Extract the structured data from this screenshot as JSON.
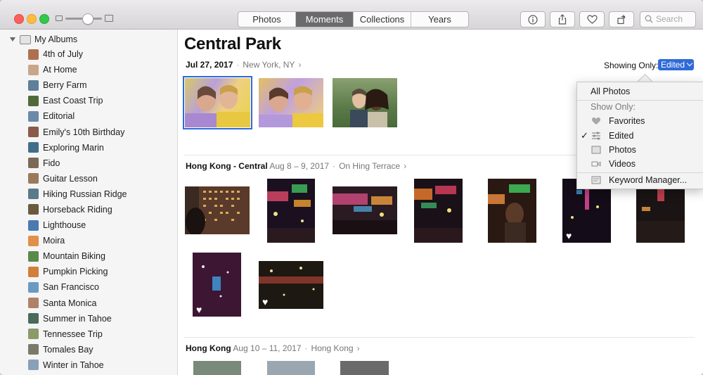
{
  "toolbar": {
    "tabs": [
      {
        "label": "Photos",
        "active": false
      },
      {
        "label": "Moments",
        "active": true
      },
      {
        "label": "Collections",
        "active": false
      },
      {
        "label": "Years",
        "active": false
      }
    ],
    "buttons": [
      "info-icon",
      "share-icon",
      "heart-icon",
      "rotate-icon"
    ],
    "search_placeholder": "Search"
  },
  "sidebar": {
    "header": "My Albums",
    "items": [
      {
        "label": "4th of July",
        "color": "#b07050"
      },
      {
        "label": "At Home",
        "color": "#c9a58a"
      },
      {
        "label": "Berry Farm",
        "color": "#5f7f9a"
      },
      {
        "label": "East Coast Trip",
        "color": "#4f6a3a"
      },
      {
        "label": "Editorial",
        "color": "#6c8aa8"
      },
      {
        "label": "Emily's 10th Birthday",
        "color": "#8a5a4a"
      },
      {
        "label": "Exploring Marin",
        "color": "#3f6f8a"
      },
      {
        "label": "Fido",
        "color": "#7a6a55"
      },
      {
        "label": "Guitar Lesson",
        "color": "#9a7a5a"
      },
      {
        "label": "Hiking Russian Ridge",
        "color": "#5a7a8a"
      },
      {
        "label": "Horseback Riding",
        "color": "#6a5a3f"
      },
      {
        "label": "Lighthouse",
        "color": "#4a7ab0"
      },
      {
        "label": "Moira",
        "color": "#e0904a"
      },
      {
        "label": "Mountain Biking",
        "color": "#5a8a4a"
      },
      {
        "label": "Pumpkin Picking",
        "color": "#d0803a"
      },
      {
        "label": "San Francisco",
        "color": "#6a9ac0"
      },
      {
        "label": "Santa Monica",
        "color": "#b0806a"
      },
      {
        "label": "Summer in Tahoe",
        "color": "#4a6a5a"
      },
      {
        "label": "Tennessee Trip",
        "color": "#8a9a6a"
      },
      {
        "label": "Tomales Bay",
        "color": "#7a7a6a"
      },
      {
        "label": "Winter in Tahoe",
        "color": "#8aa0b8"
      }
    ]
  },
  "main": {
    "title": "Central Park",
    "filter": {
      "label": "Showing Only:",
      "value": "Edited"
    },
    "sections": [
      {
        "title": "Jul 27, 2017",
        "subtitle": "",
        "location": "New York, NY"
      },
      {
        "title": "Hong Kong - Central",
        "subtitle": "Aug 8 – 9, 2017",
        "location": "On Hing Terrace"
      },
      {
        "title": "Hong Kong",
        "subtitle": "Aug 10 – 11, 2017",
        "location": "Hong Kong"
      }
    ]
  },
  "menu": {
    "all_photos": "All Photos",
    "show_only_header": "Show Only:",
    "options": [
      {
        "label": "Favorites",
        "icon": "heart-icon",
        "checked": false
      },
      {
        "label": "Edited",
        "icon": "sliders-icon",
        "checked": true
      },
      {
        "label": "Photos",
        "icon": "photo-icon",
        "checked": false
      },
      {
        "label": "Videos",
        "icon": "video-icon",
        "checked": false
      }
    ],
    "keyword_manager": "Keyword Manager..."
  },
  "colors": {
    "accent": "#2f6bd8",
    "close": "#fc605c",
    "minimize": "#fdbc40",
    "maximize": "#34c84a"
  }
}
